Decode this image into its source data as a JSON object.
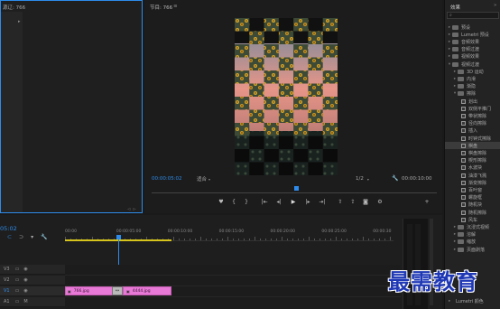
{
  "source_monitor": {
    "title": "源辽: 766",
    "arrow": "▸"
  },
  "program_monitor": {
    "title": "节目: 766",
    "menu_icon": "≡",
    "timecode_current": "00:00:05:02",
    "fit_label": "适合",
    "quality_label": "1/2",
    "timecode_total": "00:00:10:00"
  },
  "effects_panel": {
    "title": "效果",
    "menu_icon": "»",
    "search_placeholder": "",
    "items": [
      {
        "label": "预设",
        "type": "folder",
        "level": 0
      },
      {
        "label": "Lumetri 预设",
        "type": "folder",
        "level": 0
      },
      {
        "label": "音频效果",
        "type": "folder",
        "level": 0
      },
      {
        "label": "音频过渡",
        "type": "folder",
        "level": 0
      },
      {
        "label": "视频效果",
        "type": "folder",
        "level": 0
      },
      {
        "label": "视频过渡",
        "type": "folder",
        "level": 0,
        "open": true
      },
      {
        "label": "3D 运动",
        "type": "folder",
        "level": 1
      },
      {
        "label": "内滑",
        "type": "folder",
        "level": 1
      },
      {
        "label": "渐隐",
        "type": "folder",
        "level": 1
      },
      {
        "label": "擦除",
        "type": "folder",
        "level": 1,
        "open": true
      },
      {
        "label": "划出",
        "type": "effect",
        "level": 2
      },
      {
        "label": "双侧平推门",
        "type": "effect",
        "level": 2
      },
      {
        "label": "带状擦除",
        "type": "effect",
        "level": 2
      },
      {
        "label": "径向擦除",
        "type": "effect",
        "level": 2
      },
      {
        "label": "插入",
        "type": "effect",
        "level": 2
      },
      {
        "label": "时钟式擦除",
        "type": "effect",
        "level": 2
      },
      {
        "label": "棋盘",
        "type": "effect",
        "level": 2,
        "selected": true
      },
      {
        "label": "棋盘擦除",
        "type": "effect",
        "level": 2
      },
      {
        "label": "楔形擦除",
        "type": "effect",
        "level": 2
      },
      {
        "label": "水波块",
        "type": "effect",
        "level": 2
      },
      {
        "label": "油漆飞溅",
        "type": "effect",
        "level": 2
      },
      {
        "label": "渐变擦除",
        "type": "effect",
        "level": 2
      },
      {
        "label": "百叶窗",
        "type": "effect",
        "level": 2
      },
      {
        "label": "螺旋框",
        "type": "effect",
        "level": 2
      },
      {
        "label": "随机块",
        "type": "effect",
        "level": 2
      },
      {
        "label": "随机擦除",
        "type": "effect",
        "level": 2
      },
      {
        "label": "风车",
        "type": "effect",
        "level": 2
      },
      {
        "label": "沉浸式视频",
        "type": "folder",
        "level": 1
      },
      {
        "label": "溶解",
        "type": "folder",
        "level": 1
      },
      {
        "label": "缩放",
        "type": "folder",
        "level": 1
      },
      {
        "label": "页面剥落",
        "type": "folder",
        "level": 1
      }
    ],
    "lumetri_color": "Lumetri 颜色"
  },
  "timeline": {
    "timecode": "05:02",
    "ruler_labels": [
      "00:00",
      "00:00:05:00",
      "00:00:10:00",
      "00:00:15:00",
      "00:00:20:00",
      "00:00:25:00",
      "00:00:30"
    ],
    "tracks": [
      "V3",
      "V2",
      "V1",
      "A1"
    ],
    "clip_a_label": "766.jpg",
    "clip_b_label": "4444.jpg",
    "transition_icon": "↔"
  },
  "watermark": "最需教育",
  "colors": {
    "accent_blue": "#2d8ceb",
    "clip_pink": "#e879d6",
    "yellow_bar": "#d6c31c"
  }
}
